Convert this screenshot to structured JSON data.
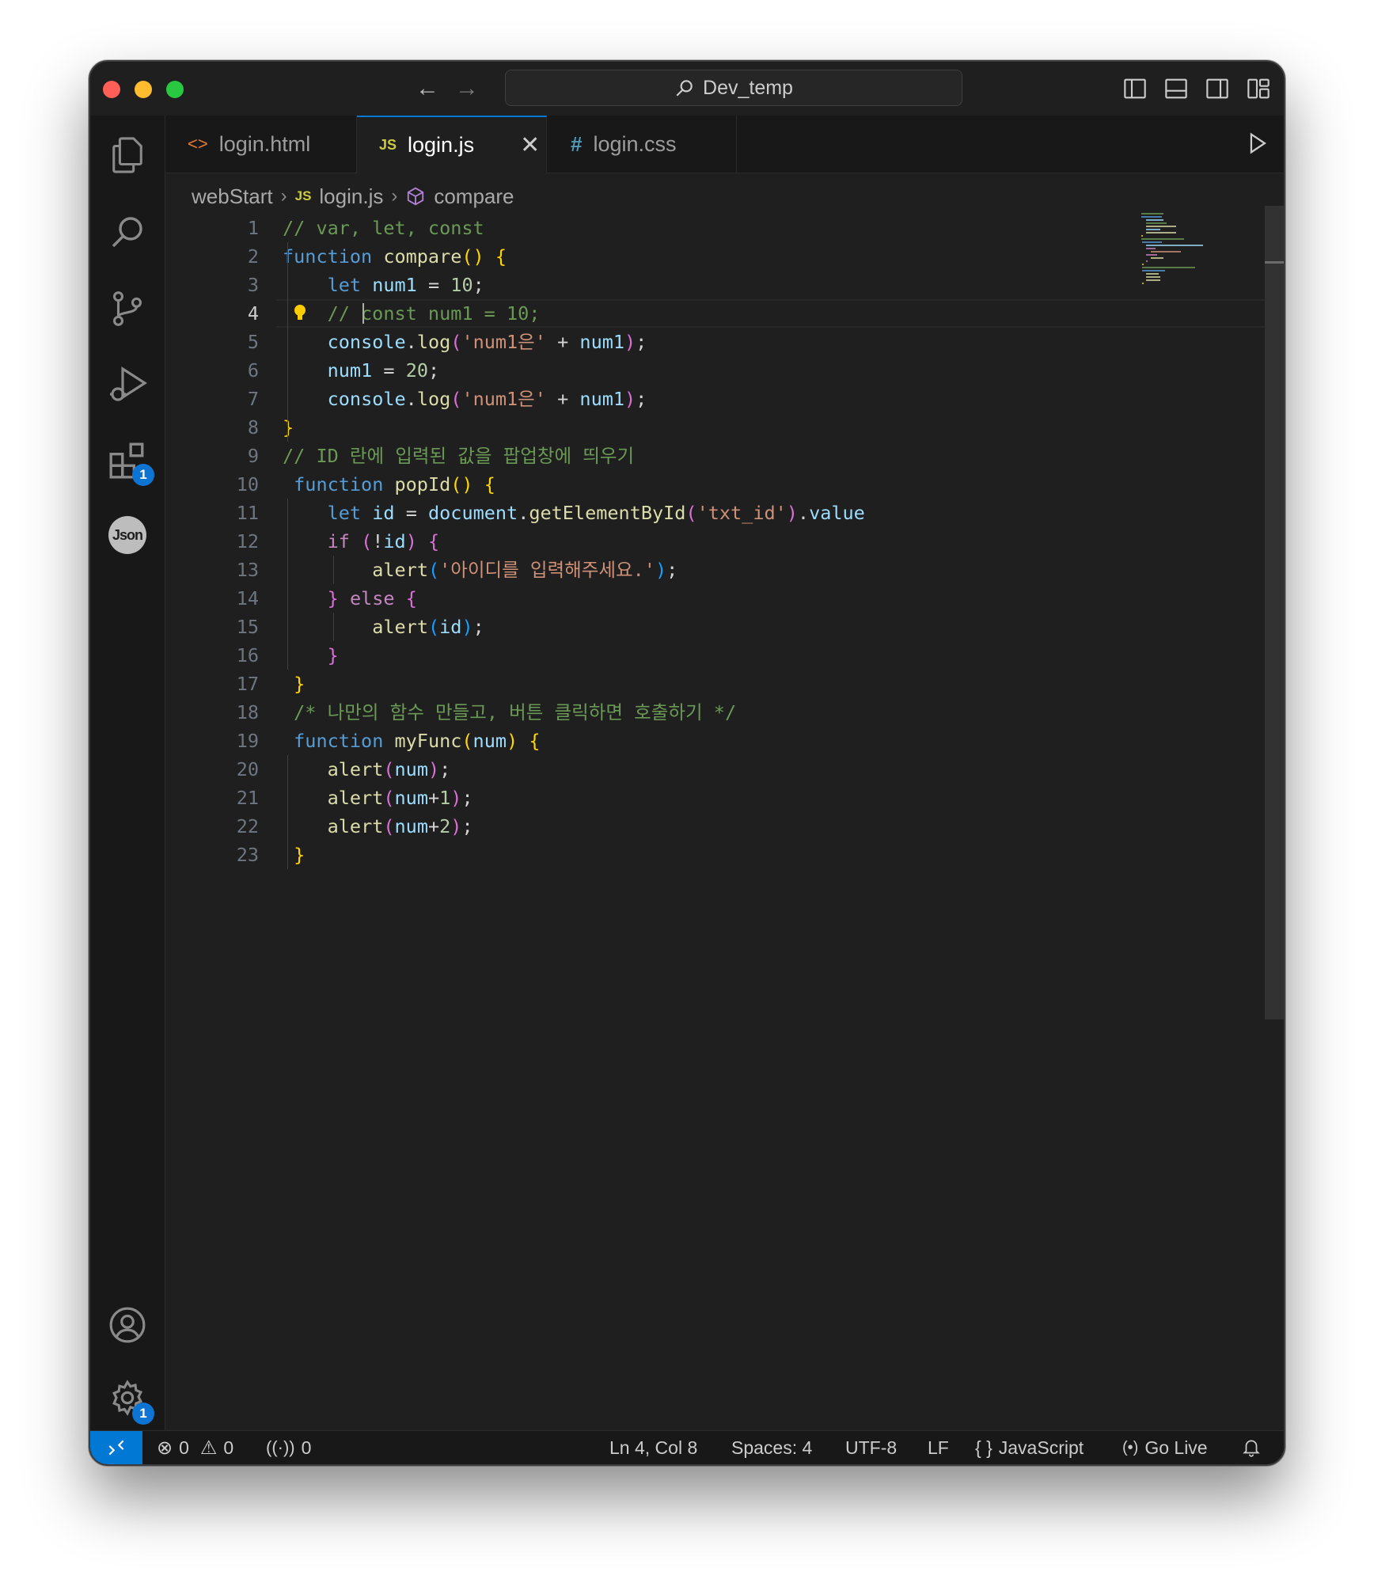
{
  "window": {
    "search_text": "Dev_temp"
  },
  "tabs": [
    {
      "label": "login.html",
      "icon": "html-icon"
    },
    {
      "label": "login.js",
      "icon": "js-icon",
      "icon_text": "JS",
      "active": true
    },
    {
      "label": "login.css",
      "icon": "css-icon",
      "icon_text": "#"
    }
  ],
  "breadcrumb": {
    "folder": "webStart",
    "file_icon": "JS",
    "file": "login.js",
    "symbol": "compare"
  },
  "activity_badges": {
    "extensions": "1",
    "settings": "1"
  },
  "json_icon_label": "Json",
  "code": {
    "current_line": 4,
    "lines": [
      "// var, let, const",
      "function compare() {",
      "    let num1 = 10;",
      "    // const num1 = 10;",
      "    console.log('num1은' + num1);",
      "    num1 = 20;",
      "    console.log('num1은' + num1);",
      "}",
      "// ID 란에 입력된 값을 팝업창에 띄우기",
      " function popId() {",
      "    let id = document.getElementById('txt_id').value",
      "    if (!id) {",
      "        alert('아이디를 입력해주세요.');",
      "    } else {",
      "        alert(id);",
      "    }",
      " }",
      " /* 나만의 함수 만들고, 버튼 클릭하면 호출하기 */",
      " function myFunc(num) {",
      "    alert(num);",
      "    alert(num+1);",
      "    alert(num+2);",
      " }"
    ]
  },
  "status": {
    "errors": "0",
    "warnings": "0",
    "ports": "0",
    "position": "Ln 4, Col 8",
    "spaces": "Spaces: 4",
    "encoding": "UTF-8",
    "eol": "LF",
    "language": "JavaScript",
    "language_icon": "{ }",
    "go_live": "Go Live"
  },
  "colors": {
    "accent": "#0078d4",
    "comment": "#6a9955",
    "keyword": "#569cd6",
    "function": "#dcdcaa",
    "variable": "#9cdcfe",
    "string": "#ce9178",
    "number": "#b5cea8"
  }
}
